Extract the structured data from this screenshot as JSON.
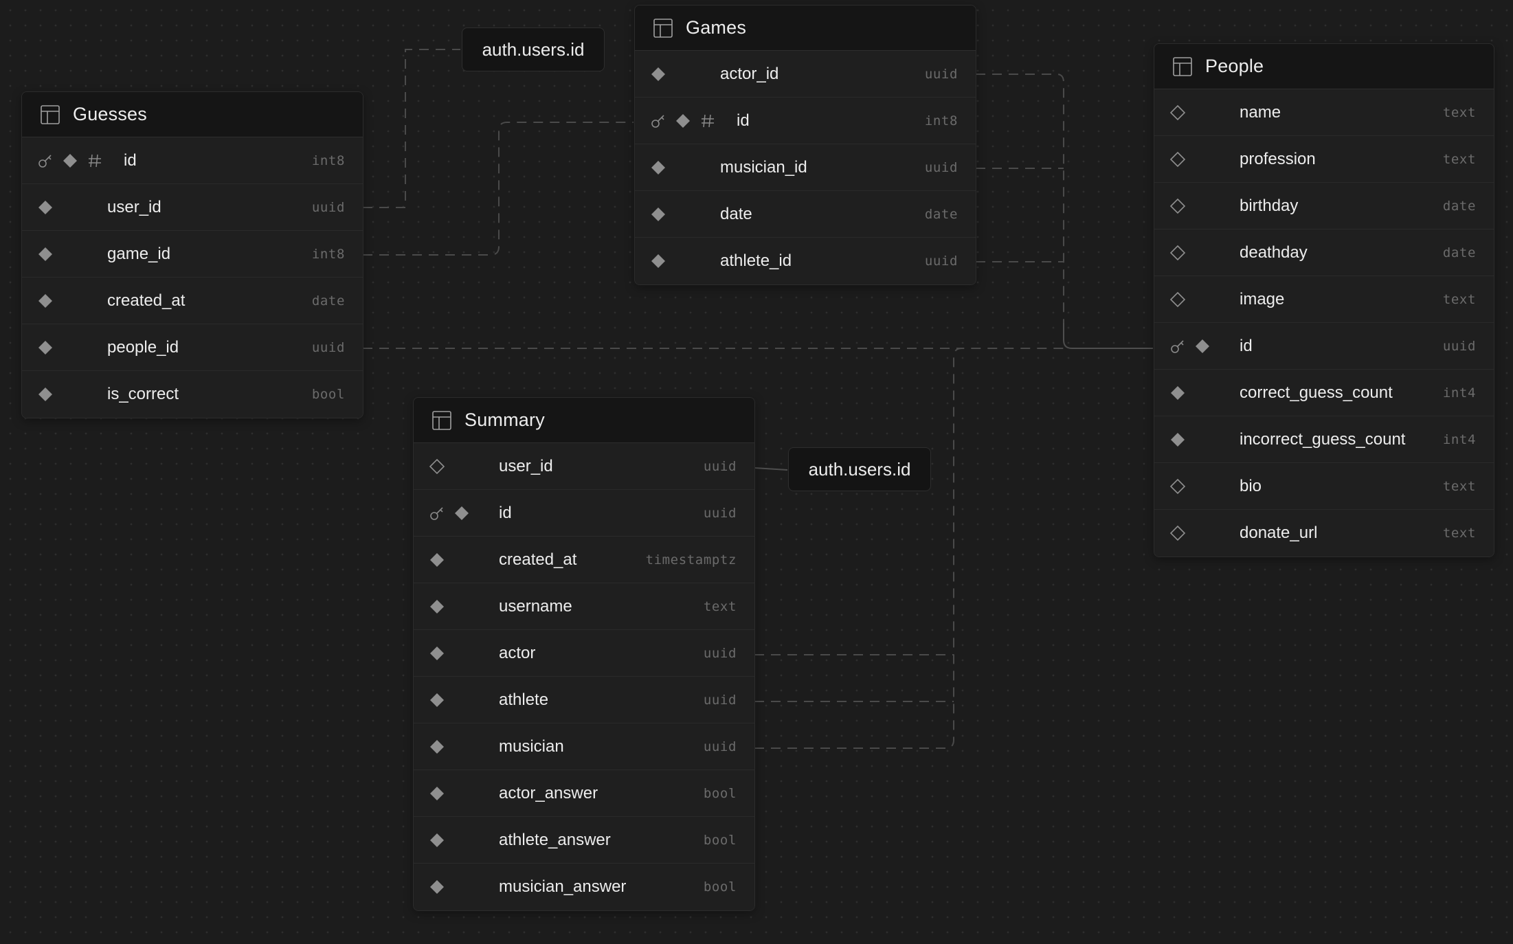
{
  "refs": [
    {
      "id": "ref-auth-top",
      "label": "auth.users.id"
    },
    {
      "id": "ref-auth-mid",
      "label": "auth.users.id"
    }
  ],
  "tables": [
    {
      "id": "guesses",
      "title": "Guesses",
      "columns": [
        {
          "name": "id",
          "type": "int8",
          "primary": true,
          "identity": true,
          "nullable": false
        },
        {
          "name": "user_id",
          "type": "uuid",
          "primary": false,
          "identity": false,
          "nullable": false
        },
        {
          "name": "game_id",
          "type": "int8",
          "primary": false,
          "identity": false,
          "nullable": false
        },
        {
          "name": "created_at",
          "type": "date",
          "primary": false,
          "identity": false,
          "nullable": false
        },
        {
          "name": "people_id",
          "type": "uuid",
          "primary": false,
          "identity": false,
          "nullable": false
        },
        {
          "name": "is_correct",
          "type": "bool",
          "primary": false,
          "identity": false,
          "nullable": false
        }
      ]
    },
    {
      "id": "games",
      "title": "Games",
      "columns": [
        {
          "name": "actor_id",
          "type": "uuid",
          "primary": false,
          "identity": false,
          "nullable": false
        },
        {
          "name": "id",
          "type": "int8",
          "primary": true,
          "identity": true,
          "nullable": false
        },
        {
          "name": "musician_id",
          "type": "uuid",
          "primary": false,
          "identity": false,
          "nullable": false
        },
        {
          "name": "date",
          "type": "date",
          "primary": false,
          "identity": false,
          "nullable": false
        },
        {
          "name": "athlete_id",
          "type": "uuid",
          "primary": false,
          "identity": false,
          "nullable": false
        }
      ]
    },
    {
      "id": "people",
      "title": "People",
      "columns": [
        {
          "name": "name",
          "type": "text",
          "primary": false,
          "identity": false,
          "nullable": true
        },
        {
          "name": "profession",
          "type": "text",
          "primary": false,
          "identity": false,
          "nullable": true
        },
        {
          "name": "birthday",
          "type": "date",
          "primary": false,
          "identity": false,
          "nullable": true
        },
        {
          "name": "deathday",
          "type": "date",
          "primary": false,
          "identity": false,
          "nullable": true
        },
        {
          "name": "image",
          "type": "text",
          "primary": false,
          "identity": false,
          "nullable": true
        },
        {
          "name": "id",
          "type": "uuid",
          "primary": true,
          "identity": false,
          "nullable": false
        },
        {
          "name": "correct_guess_count",
          "type": "int4",
          "primary": false,
          "identity": false,
          "nullable": false
        },
        {
          "name": "incorrect_guess_count",
          "type": "int4",
          "primary": false,
          "identity": false,
          "nullable": false
        },
        {
          "name": "bio",
          "type": "text",
          "primary": false,
          "identity": false,
          "nullable": true
        },
        {
          "name": "donate_url",
          "type": "text",
          "primary": false,
          "identity": false,
          "nullable": true
        }
      ]
    },
    {
      "id": "summary",
      "title": "Summary",
      "columns": [
        {
          "name": "user_id",
          "type": "uuid",
          "primary": false,
          "identity": false,
          "nullable": true
        },
        {
          "name": "id",
          "type": "uuid",
          "primary": true,
          "identity": false,
          "nullable": false
        },
        {
          "name": "created_at",
          "type": "timestamptz",
          "primary": false,
          "identity": false,
          "nullable": false
        },
        {
          "name": "username",
          "type": "text",
          "primary": false,
          "identity": false,
          "nullable": false
        },
        {
          "name": "actor",
          "type": "uuid",
          "primary": false,
          "identity": false,
          "nullable": false
        },
        {
          "name": "athlete",
          "type": "uuid",
          "primary": false,
          "identity": false,
          "nullable": false
        },
        {
          "name": "musician",
          "type": "uuid",
          "primary": false,
          "identity": false,
          "nullable": false
        },
        {
          "name": "actor_answer",
          "type": "bool",
          "primary": false,
          "identity": false,
          "nullable": false
        },
        {
          "name": "athlete_answer",
          "type": "bool",
          "primary": false,
          "identity": false,
          "nullable": false
        },
        {
          "name": "musician_answer",
          "type": "bool",
          "primary": false,
          "identity": false,
          "nullable": false
        }
      ]
    }
  ],
  "colors": {
    "canvas": "#1c1c1c",
    "table_body": "#1f1f1f",
    "table_header": "#151515",
    "text": "#ededed",
    "type_text": "#6b6b6b",
    "edge": "#4a4a4a",
    "marker": "#8f8f8f"
  }
}
